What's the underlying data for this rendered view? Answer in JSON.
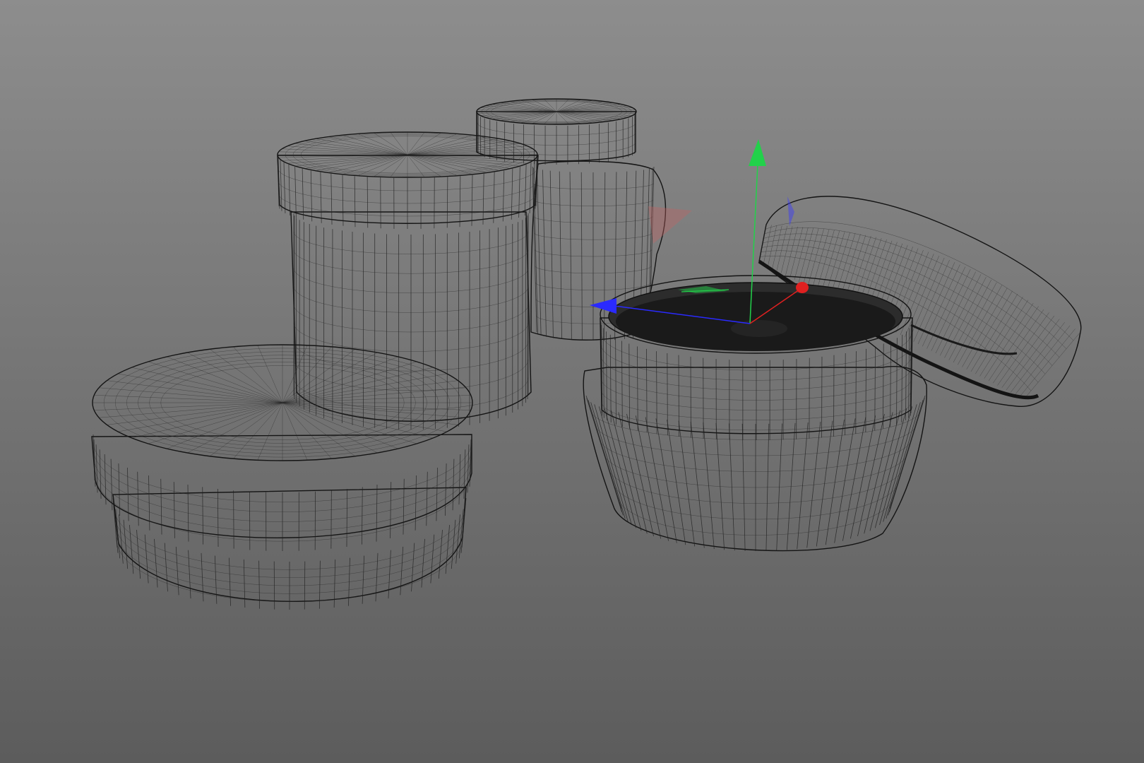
{
  "viewport": {
    "background_top": "#8c8c8c",
    "background_bottom": "#5e5e5e",
    "mesh_color": "#5a5a5a",
    "wire_color": "#1e1e1e",
    "display_mode": "wireframe-on-shaded"
  },
  "objects": [
    {
      "name": "tall-jar-with-lid",
      "selected": false
    },
    {
      "name": "bulb-jar-with-lid",
      "selected": false
    },
    {
      "name": "flat-round-jar-with-lid",
      "selected": false
    },
    {
      "name": "open-cream-jar",
      "selected": true
    },
    {
      "name": "open-cream-jar-lid",
      "selected": false
    }
  ],
  "gizmo": {
    "type": "move-transform-gizmo",
    "axes": [
      {
        "axis": "x",
        "color": "#e02020"
      },
      {
        "axis": "y",
        "color": "#22d14a"
      },
      {
        "axis": "z",
        "color": "#2a2aff"
      }
    ]
  },
  "cream_color": "#1a1a1a"
}
